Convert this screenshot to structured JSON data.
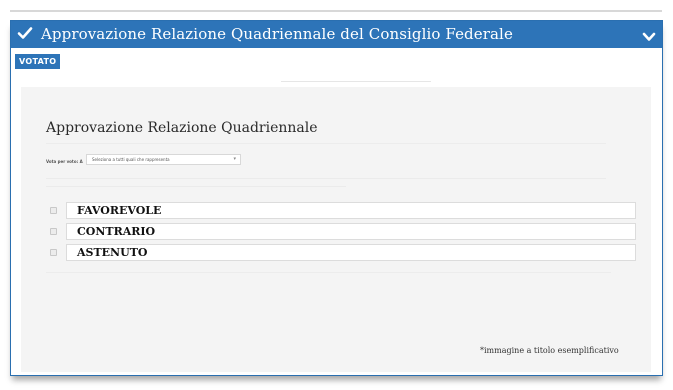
{
  "header": {
    "title": "Approvazione Relazione Quadriennale del Consiglio Federale",
    "check_icon": "check-icon",
    "toggle_icon": "chevron-down-icon",
    "color": "#2d74b8"
  },
  "badge": {
    "label": "VOTATO"
  },
  "content": {
    "title": "Approvazione Relazione Quadriennale",
    "sort": {
      "label": "Vota per voto: A",
      "selected": "Seleziona a tutti quali che rappresenta"
    },
    "options": [
      {
        "label": "FAVOREVOLE"
      },
      {
        "label": "CONTRARIO"
      },
      {
        "label": "ASTENUTO"
      }
    ]
  },
  "footnote": "*immagine a titolo esemplificativo"
}
